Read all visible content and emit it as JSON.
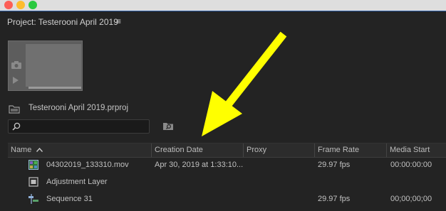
{
  "window": {
    "title": ""
  },
  "panel": {
    "title": "Project: Testerooni April 2019",
    "menu_glyph": "≡"
  },
  "project": {
    "file_name": "Testerooni April 2019.prproj"
  },
  "search": {
    "value": "",
    "placeholder": ""
  },
  "table": {
    "columns": [
      "Name",
      "Creation Date",
      "Proxy",
      "Frame Rate",
      "Media Start"
    ],
    "sort_column": "Name",
    "rows": [
      {
        "icon": "video-clip-icon",
        "name": "04302019_133310.mov",
        "creation_date": "Apr 30, 2019 at 1:33:10...",
        "proxy": "",
        "frame_rate": "29.97 fps",
        "media_start": "00:00:00:00"
      },
      {
        "icon": "adjustment-layer-icon",
        "name": "Adjustment Layer",
        "creation_date": "",
        "proxy": "",
        "frame_rate": "",
        "media_start": ""
      },
      {
        "icon": "sequence-icon",
        "name": "Sequence 31",
        "creation_date": "",
        "proxy": "",
        "frame_rate": "29.97 fps",
        "media_start": "00;00;00;00"
      }
    ]
  },
  "annotation": {
    "arrow_color": "#ffff00"
  },
  "colors": {
    "background": "#232323",
    "text": "#bdbdbd",
    "title_bar": "#dedede"
  }
}
